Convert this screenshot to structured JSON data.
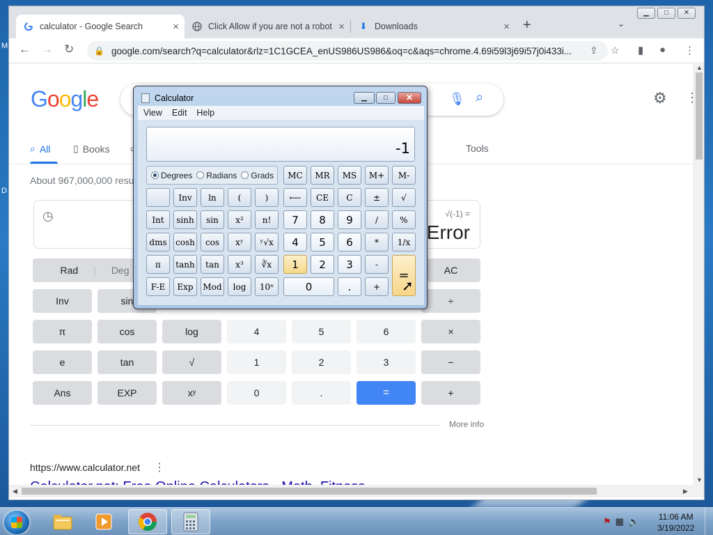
{
  "browser": {
    "tabs": [
      {
        "title": "calculator - Google Search",
        "icon": "google-g-icon",
        "active": true
      },
      {
        "title": "Click Allow if you are not a robot",
        "icon": "globe-icon",
        "active": false
      },
      {
        "title": "Downloads",
        "icon": "download-icon",
        "active": false
      }
    ],
    "new_tab": "+",
    "tab_search": "⌄",
    "url": "google.com/search?q=calculator&rlz=1C1GCEA_enUS986US986&oq=c&aqs=chrome.4.69i59l3j69i57j0i433i..."
  },
  "google": {
    "logo": "Google",
    "nav_tabs": {
      "all": "All",
      "books": "Books",
      "tools": "Tools"
    },
    "stats": "About 967,000,000 resu",
    "calc": {
      "expression": "√(-1) =",
      "result": "Error",
      "buttons": {
        "rad": "Rad",
        "deg": "Deg",
        "ac": "AC",
        "inv": "Inv",
        "sin": "sin",
        "divide": "÷",
        "pi": "π",
        "cos": "cos",
        "log": "log",
        "n4": "4",
        "n5": "5",
        "n6": "6",
        "times": "×",
        "e": "e",
        "tan": "tan",
        "sqrt": "√",
        "n1": "1",
        "n2": "2",
        "n3": "3",
        "minus": "−",
        "ans": "Ans",
        "exp": "EXP",
        "pow": "xʸ",
        "n0": "0",
        "dot": ".",
        "equals": "=",
        "plus": "+"
      }
    },
    "more_info": "More info",
    "result_url": "https://www.calculator.net",
    "result_title": "Calculator.net: Free Online Calculators - Math, Fitness ..."
  },
  "win_calc": {
    "title": "Calculator",
    "menu": {
      "view": "View",
      "edit": "Edit",
      "help": "Help"
    },
    "display": "-1",
    "angle": {
      "degrees": "Degrees",
      "radians": "Radians",
      "grads": "Grads",
      "selected": "Degrees"
    },
    "keys": {
      "mc": "MC",
      "mr": "MR",
      "ms": "MS",
      "mplus": "M+",
      "mminus": "M-",
      "blank": "",
      "inv": "Inv",
      "ln": "ln",
      "lparen": "(",
      "rparen": ")",
      "back": "⟵",
      "ce": "CE",
      "c": "C",
      "pm": "±",
      "sqrt": "√",
      "int": "Int",
      "sinh": "sinh",
      "sin": "sin",
      "xsq": "x²",
      "fact": "n!",
      "k7": "7",
      "k8": "8",
      "k9": "9",
      "div": "/",
      "pct": "%",
      "dms": "dms",
      "cosh": "cosh",
      "cos": "cos",
      "xy": "xʸ",
      "yroot": "ʸ√x",
      "k4": "4",
      "k5": "5",
      "k6": "6",
      "mul": "*",
      "recip": "1/x",
      "pi": "π",
      "tanh": "tanh",
      "tan": "tan",
      "xcube": "x³",
      "croot": "∛x",
      "k1": "1",
      "k2": "2",
      "k3": "3",
      "sub": "-",
      "eq": "=",
      "fe": "F-E",
      "exp": "Exp",
      "mod": "Mod",
      "log": "log",
      "tenx": "10ˣ",
      "k0": "0",
      "dot": ".",
      "add": "+"
    }
  },
  "taskbar": {
    "time": "11:06 AM",
    "date": "3/19/2022"
  }
}
